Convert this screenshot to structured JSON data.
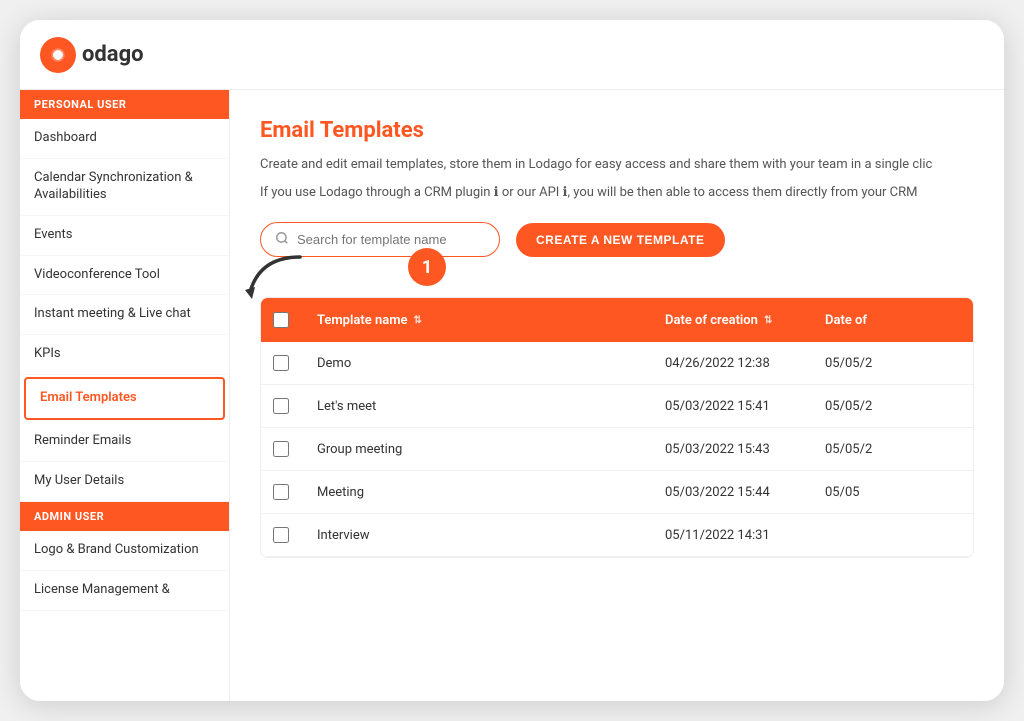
{
  "app": {
    "logo_text": "odago",
    "title": "Lodago"
  },
  "sidebar": {
    "personal_user_label": "PERSONAL USER",
    "admin_user_label": "ADMIN USER",
    "items": [
      {
        "id": "dashboard",
        "label": "Dashboard"
      },
      {
        "id": "calendar-sync",
        "label": "Calendar Synchronization & Availabilities"
      },
      {
        "id": "events",
        "label": "Events"
      },
      {
        "id": "videoconference",
        "label": "Videoconference Tool"
      },
      {
        "id": "instant-meeting",
        "label": "Instant meeting & Live chat"
      },
      {
        "id": "kpis",
        "label": "KPIs"
      },
      {
        "id": "email-templates",
        "label": "Email Templates",
        "active": true
      },
      {
        "id": "reminder-emails",
        "label": "Reminder Emails"
      },
      {
        "id": "my-user-details",
        "label": "My User Details"
      }
    ],
    "admin_items": [
      {
        "id": "logo-brand",
        "label": "Logo & Brand Customization"
      },
      {
        "id": "license-management",
        "label": "License Management &"
      }
    ]
  },
  "main": {
    "page_title": "Email Templates",
    "description1": "Create and edit email templates, store them in Lodago for easy access and share them with your team in a single clic",
    "description2": "If you use Lodago through a CRM plugin ℹ or our API ℹ, you will be then able to access them directly from your CRM",
    "search_placeholder": "Search for template name",
    "create_button_label": "CREATE A NEW TEMPLATE",
    "step_number": "1",
    "table": {
      "columns": [
        {
          "id": "checkbox",
          "label": ""
        },
        {
          "id": "template-name",
          "label": "Template name",
          "sortable": true
        },
        {
          "id": "date-creation",
          "label": "Date of creation",
          "sortable": true
        },
        {
          "id": "date-modified",
          "label": "Date of",
          "sortable": false
        }
      ],
      "rows": [
        {
          "id": 1,
          "name": "Demo",
          "date_creation": "04/26/2022 12:38",
          "date_modified": "05/05/2"
        },
        {
          "id": 2,
          "name": "Let's meet",
          "date_creation": "05/03/2022 15:41",
          "date_modified": "05/05/2"
        },
        {
          "id": 3,
          "name": "Group meeting",
          "date_creation": "05/03/2022 15:43",
          "date_modified": "05/05/2"
        },
        {
          "id": 4,
          "name": "Meeting",
          "date_creation": "05/03/2022 15:44",
          "date_modified": "05/05"
        },
        {
          "id": 5,
          "name": "Interview",
          "date_creation": "05/11/2022 14:31",
          "date_modified": ""
        }
      ]
    }
  },
  "colors": {
    "primary": "#ff5722",
    "text_dark": "#333333",
    "text_muted": "#999999"
  }
}
